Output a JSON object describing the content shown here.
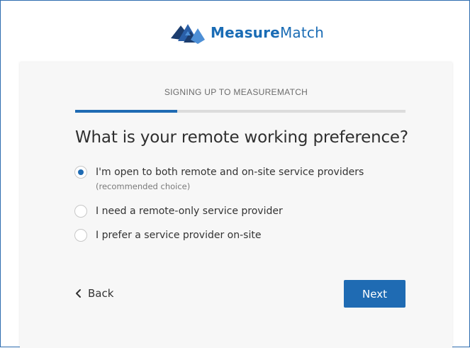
{
  "brand": {
    "logo_icon": "measurematch-mountain-logo-icon",
    "name_bold": "Measure",
    "name_light": "Match",
    "colors": {
      "primary": "#1f6bb3",
      "logo_dark": "#1c3d6e",
      "logo_light": "#4d8fd6"
    }
  },
  "signup": {
    "step_title": "SIGNING UP TO MEASUREMATCH",
    "progress": 0.31,
    "question": "What is your remote working preference?",
    "options": [
      {
        "label": "I'm open to both remote and on-site service providers",
        "sublabel": "(recommended choice)",
        "selected": true
      },
      {
        "label": "I need a remote-only service provider",
        "selected": false
      },
      {
        "label": "I prefer a service provider on-site",
        "selected": false
      }
    ]
  },
  "nav": {
    "back_icon": "chevron-left-icon",
    "back_label": "Back",
    "next_label": "Next"
  }
}
